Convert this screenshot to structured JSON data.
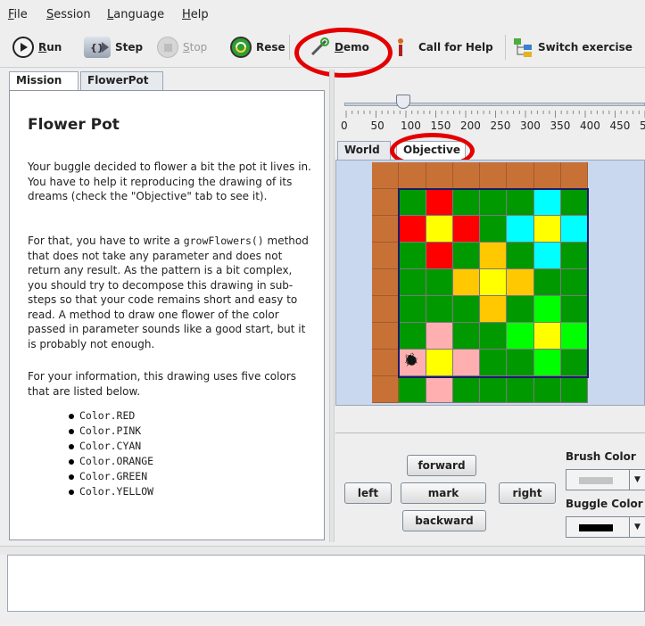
{
  "menu": {
    "file": {
      "hot": "F",
      "rest": "ile"
    },
    "session": {
      "hot": "S",
      "rest": "ession"
    },
    "language": {
      "hot": "L",
      "rest": "anguage"
    },
    "help": {
      "hot": "H",
      "rest": "elp"
    }
  },
  "toolbar": {
    "run": {
      "hot": "R",
      "rest": "un",
      "icon": "play-icon"
    },
    "step": {
      "label": "Step",
      "icon": "step-icon"
    },
    "stop": {
      "hot": "S",
      "rest": "top",
      "icon": "stop-icon"
    },
    "reset": {
      "label": "Rese",
      "icon": "reset-icon"
    },
    "demo": {
      "hot": "D",
      "rest": "emo",
      "icon": "wand-icon"
    },
    "help": {
      "label": "Call for Help",
      "icon": "help-figure-icon"
    },
    "switch": {
      "label": "Switch exercise",
      "icon": "exercise-tree-icon"
    }
  },
  "left_tabs": [
    "Mission",
    "FlowerPot"
  ],
  "mission": {
    "title": "Flower Pot",
    "p1": "Your buggle decided to flower a bit the pot it lives in. You have to help it reproducing the drawing of its dreams (check the \"Objective\" tab to see it).",
    "p2a": "For that, you have to write a ",
    "p2code": "growFlowers()",
    "p2b": " method that does not take any parameter and does not return any result. As the pattern is a bit complex, you should try to decompose this drawing in sub-steps so that your code remains short and easy to read. A method to draw one flower of the color passed in parameter sounds like a good start, but it is probably not enough.",
    "p3": "For your information, this drawing uses five colors that are listed below.",
    "colors": [
      "Color.RED",
      "Color.PINK",
      "Color.CYAN",
      "Color.ORANGE",
      "Color.GREEN",
      "Color.YELLOW"
    ]
  },
  "speed_slider": {
    "value": 100,
    "ticks": [
      "0",
      "50",
      "100",
      "150",
      "200",
      "250",
      "300",
      "350",
      "400",
      "450",
      "500"
    ]
  },
  "view_tabs": [
    "World",
    "Objective"
  ],
  "active_view_tab": "Objective",
  "world": {
    "palette": {
      "B": "#c87137",
      "G": "#009900",
      "R": "#ff0000",
      "Y": "#ffff00",
      "C": "#00ffff",
      "O": "#ffc800",
      "P": "#ffafaf",
      "L": "#00ff00"
    },
    "rows": [
      "BBBBBBBB",
      "BGRGGGCG",
      "BRYRGCYC",
      "BGRGOGCG",
      "BGGOYOGG",
      "BGGGOGLG",
      "BGPGGLYL",
      "BPYPGGLG",
      "BGPGGGGG"
    ],
    "buggle": {
      "row": 7,
      "col": 1
    }
  },
  "controls": {
    "forward": "forward",
    "left": "left",
    "mark": "mark",
    "right": "right",
    "backward": "backward",
    "brush_label": "Brush Color",
    "brush_color": "#c4c4c4",
    "buggle_label": "Buggle Color",
    "buggle_color": "#000000"
  }
}
